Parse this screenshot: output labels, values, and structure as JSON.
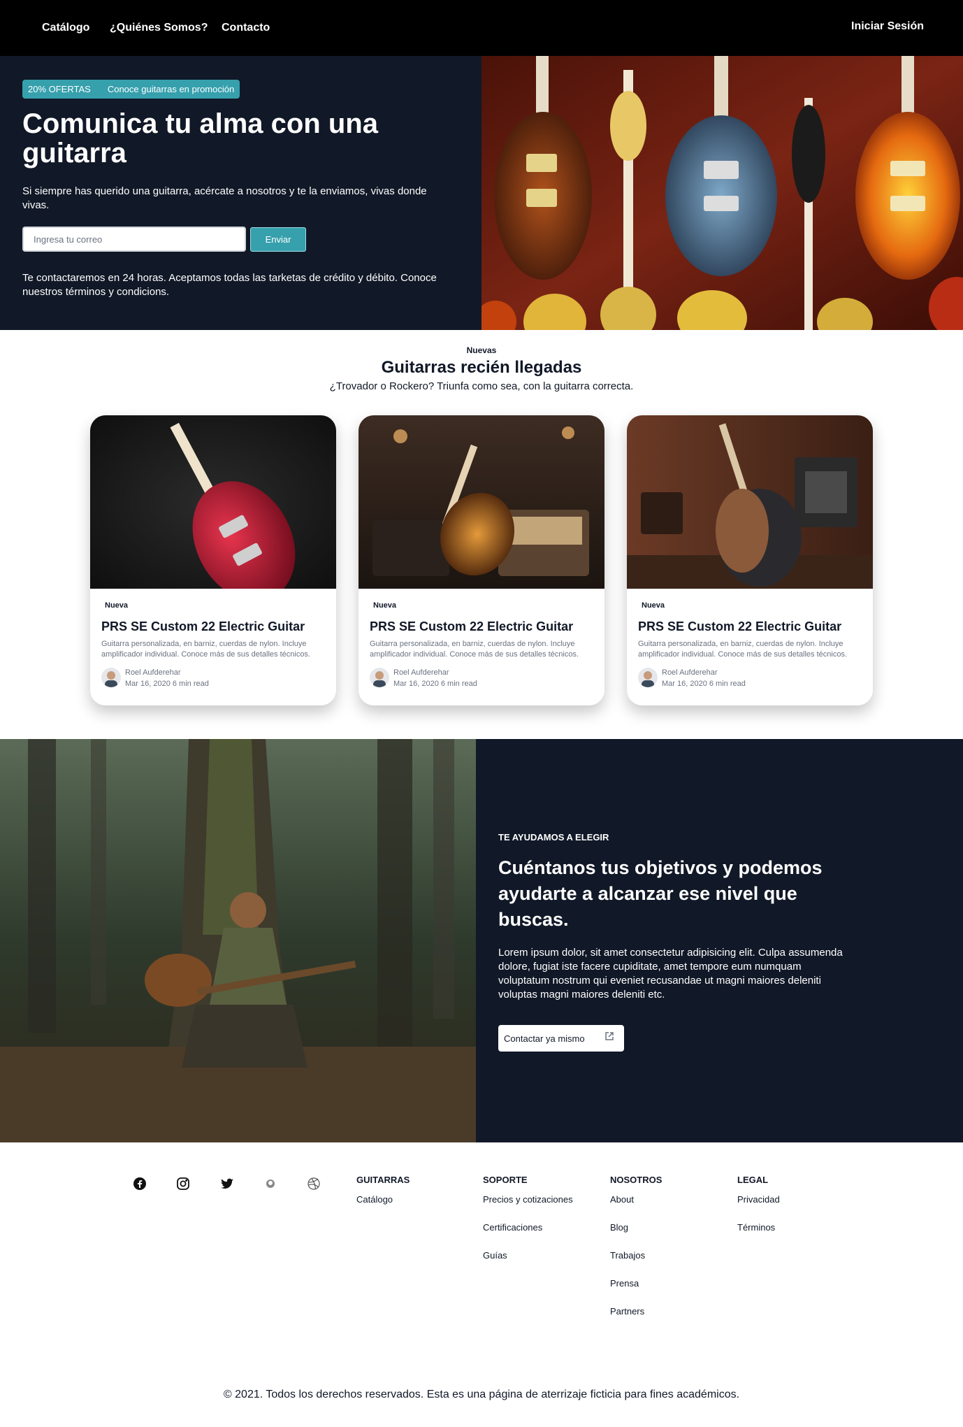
{
  "nav": {
    "links": [
      "Catálogo",
      "¿Quiénes Somos?",
      "Contacto"
    ],
    "login": "Iniciar Sesión"
  },
  "hero": {
    "promo_badge": "20% OFERTAS",
    "promo_text": "Conoce guitarras en promoción",
    "title": "Comunica tu alma con una guitarra",
    "subtitle": "Si siempre has querido una guitarra, acércate a nosotros y te la enviamos, vivas donde vivas.",
    "email_placeholder": "Ingresa tu correo",
    "email_value": "",
    "send_label": "Enviar",
    "note": "Te contactaremos en 24 horas. Aceptamos todas las tarketas de crédito y débito. Conoce nuestros términos y condicions."
  },
  "new_section": {
    "kicker": "Nuevas",
    "title": "Guitarras recién llegadas",
    "subtitle": "¿Trovador o Rockero? Triunfa como sea, con la guitarra correcta."
  },
  "cards": [
    {
      "badge": "Nueva",
      "title": "PRS SE Custom 22 Electric Guitar",
      "desc": "Guitarra personalizada, en barniz, cuerdas de nylon. Incluye amplificador individual. Conoce más de sus detalles técnicos.",
      "author": "Roel Aufderehar",
      "meta": "Mar 16, 2020 6 min read"
    },
    {
      "badge": "Nueva",
      "title": "PRS SE Custom 22 Electric Guitar",
      "desc": "Guitarra personalizada, en barniz, cuerdas de nylon. Incluye amplificador individual. Conoce más de sus detalles técnicos.",
      "author": "Roel Aufderehar",
      "meta": "Mar 16, 2020 6 min read"
    },
    {
      "badge": "Nueva",
      "title": "PRS SE Custom 22 Electric Guitar",
      "desc": "Guitarra personalizada, en barniz, cuerdas de nylon. Incluye amplificador individual. Conoce más de sus detalles técnicos.",
      "author": "Roel Aufderehar",
      "meta": "Mar 16, 2020 6 min read"
    }
  ],
  "help": {
    "kicker": "TE AYUDAMOS A ELEGIR",
    "title": "Cuéntanos tus objetivos y podemos ayudarte a alcanzar ese nivel que buscas.",
    "body": "Lorem ipsum dolor, sit amet consectetur adipisicing elit. Culpa assumenda dolore, fugiat iste facere cupiditate, amet tempore eum numquam voluptatum nostrum qui eveniet recusandae ut magni maiores deleniti voluptas magni maiores deleniti etc.",
    "cta": "Contactar ya mismo"
  },
  "footer": {
    "social_icons": [
      "facebook-icon",
      "instagram-icon",
      "twitter-icon",
      "github-icon",
      "dribbble-icon"
    ],
    "columns": [
      {
        "heading": "GUITARRAS",
        "links": [
          "Catálogo"
        ]
      },
      {
        "heading": "SOPORTE",
        "links": [
          "Precios y cotizaciones",
          "Certificaciones",
          "Guías"
        ]
      },
      {
        "heading": "NOSOTROS",
        "links": [
          "About",
          "Blog",
          "Trabajos",
          "Prensa",
          "Partners"
        ]
      },
      {
        "heading": "LEGAL",
        "links": [
          "Privacidad",
          "Términos"
        ]
      }
    ],
    "copyright": "© 2021. Todos los derechos reservados. Esta es una página de aterrizaje ficticia para fines académicos."
  },
  "colors": {
    "nav_bg": "#000000",
    "dark_bg": "#111827",
    "accent": "#36a0ad"
  }
}
